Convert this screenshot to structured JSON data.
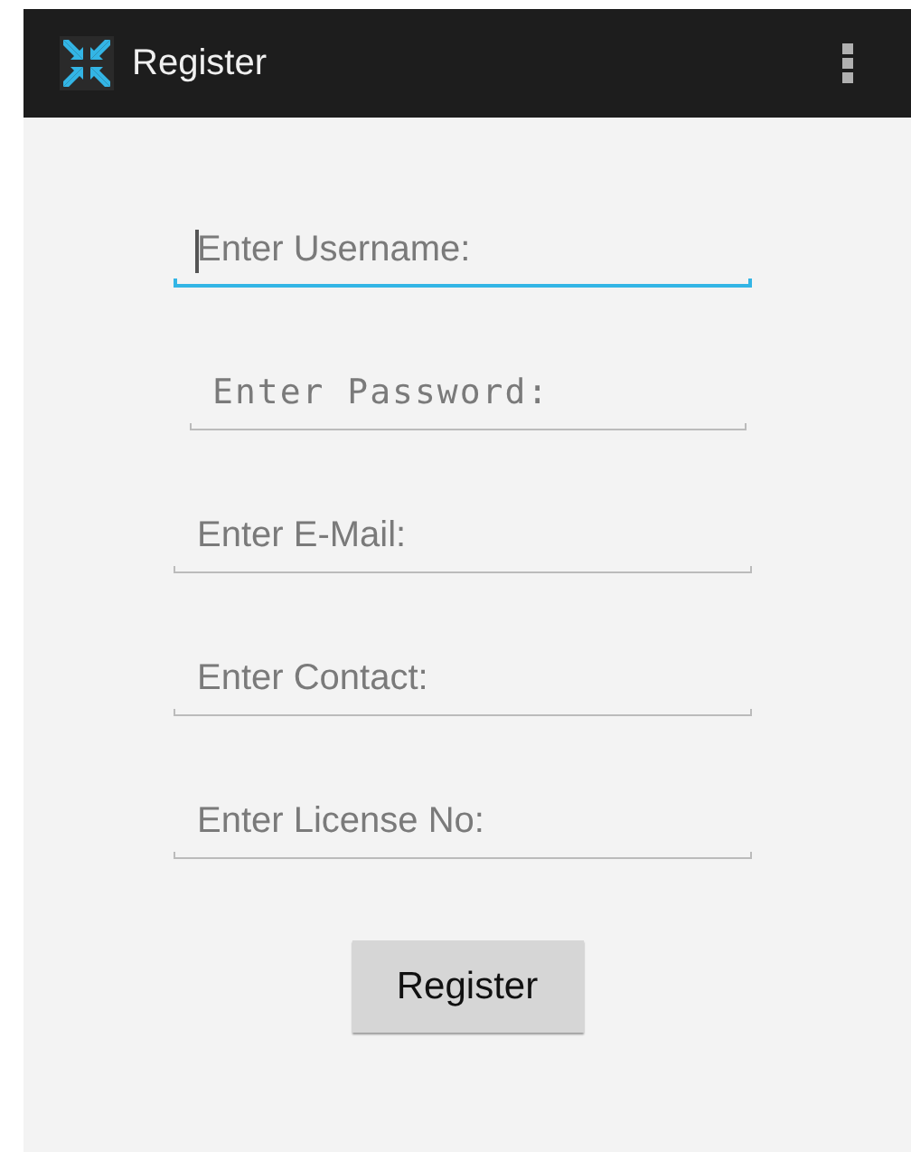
{
  "action_bar": {
    "title": "Register"
  },
  "fields": [
    {
      "placeholder": "Enter Username:",
      "kind": "text",
      "focused": true
    },
    {
      "placeholder": "Enter Password:",
      "kind": "password",
      "focused": false
    },
    {
      "placeholder": "Enter E-Mail:",
      "kind": "text",
      "focused": false
    },
    {
      "placeholder": "Enter Contact:",
      "kind": "text",
      "focused": false
    },
    {
      "placeholder": "Enter License No:",
      "kind": "text",
      "focused": false
    }
  ],
  "button": "Register"
}
